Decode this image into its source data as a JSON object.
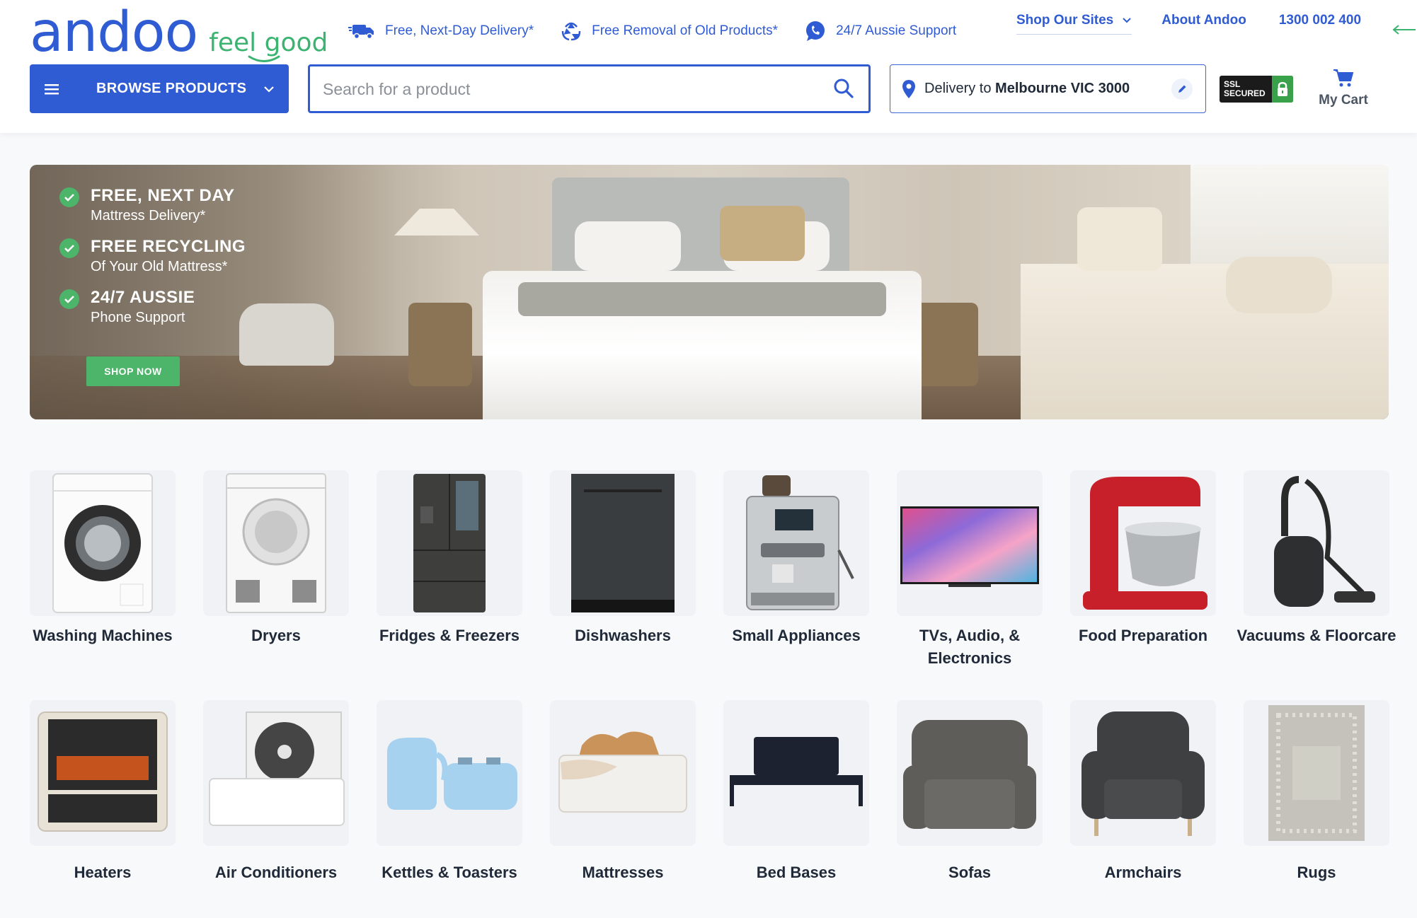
{
  "brand": {
    "logo": "andoo",
    "tagline": "feel good",
    "color": "#2f5bd3",
    "accent": "#3cb371"
  },
  "usps": [
    {
      "icon": "truck-icon",
      "label": "Free, Next-Day Delivery*"
    },
    {
      "icon": "recycle-icon",
      "label": "Free Removal of Old Products*"
    },
    {
      "icon": "phone-chat-icon",
      "label": "24/7 Aussie Support"
    }
  ],
  "top_links": {
    "sites": "Shop Our Sites",
    "about": "About Andoo",
    "phone": "1300 002 400"
  },
  "browse": {
    "label": "BROWSE PRODUCTS"
  },
  "search": {
    "placeholder": "Search for a product"
  },
  "delivery": {
    "prefix": "Delivery to ",
    "location": "Melbourne VIC 3000"
  },
  "ssl": {
    "line1": "SSL",
    "line2": "SECURED"
  },
  "cart": {
    "label": "My Cart"
  },
  "hero": {
    "items": [
      {
        "title": "FREE, NEXT DAY",
        "sub": "Mattress Delivery*"
      },
      {
        "title": "FREE RECYCLING",
        "sub": "Of Your Old Mattress*"
      },
      {
        "title": "24/7 AUSSIE",
        "sub": "Phone Support"
      }
    ],
    "cta": "SHOP NOW"
  },
  "categories": [
    {
      "label": "Washing Machines",
      "icon": "washing-machine-icon"
    },
    {
      "label": "Dryers",
      "icon": "dryer-icon"
    },
    {
      "label": "Fridges & Freezers",
      "icon": "fridge-icon"
    },
    {
      "label": "Dishwashers",
      "icon": "dishwasher-icon"
    },
    {
      "label": "Small Appliances",
      "icon": "coffee-machine-icon"
    },
    {
      "label": "TVs, Audio, & Electronics",
      "icon": "tv-icon"
    },
    {
      "label": "Food Preparation",
      "icon": "stand-mixer-icon"
    },
    {
      "label": "Vacuums & Floorcare",
      "icon": "vacuum-icon"
    },
    {
      "label": "Heaters",
      "icon": "heater-icon"
    },
    {
      "label": "Air Conditioners",
      "icon": "air-conditioner-icon"
    },
    {
      "label": "Kettles & Toasters",
      "icon": "kettle-toaster-icon"
    },
    {
      "label": "Mattresses",
      "icon": "mattress-icon"
    },
    {
      "label": "Bed Bases",
      "icon": "bed-base-icon"
    },
    {
      "label": "Sofas",
      "icon": "sofa-icon"
    },
    {
      "label": "Armchairs",
      "icon": "armchair-icon"
    },
    {
      "label": "Rugs",
      "icon": "rug-icon"
    }
  ]
}
